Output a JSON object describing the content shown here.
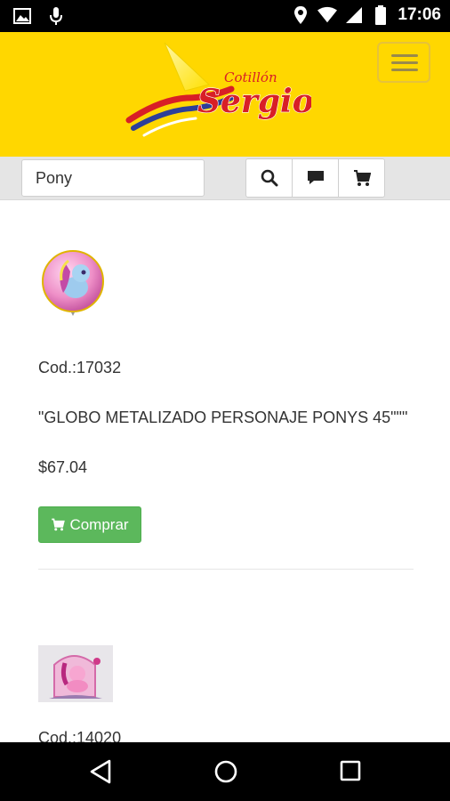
{
  "status_bar": {
    "time": "17:06",
    "icons": [
      "image-icon",
      "mic-icon",
      "location-icon",
      "wifi-icon",
      "signal-icon",
      "battery-icon"
    ]
  },
  "header": {
    "logo_text_top": "Cotillón",
    "logo_text_main": "Sergio",
    "menu_icon": "hamburger-menu-icon",
    "colors": {
      "background": "#FFD700",
      "logo_red": "#d81f26",
      "logo_blue": "#2d3f99"
    }
  },
  "search": {
    "value": "Pony",
    "buttons": [
      "search-icon",
      "chat-icon",
      "cart-icon"
    ]
  },
  "products": [
    {
      "image": "pony-balloon-image",
      "code": "Cod.:17032",
      "name": "\"GLOBO METALIZADO PERSONAJE PONYS 45\"\"\"",
      "price": "$67.04",
      "buy_label": "Comprar"
    },
    {
      "image": "pony-figure-image",
      "code": "Cod.:14020"
    }
  ],
  "colors": {
    "buy_button": "#5cb85c"
  },
  "nav_bar": {
    "icons": [
      "back-icon",
      "home-icon",
      "recents-icon"
    ]
  }
}
